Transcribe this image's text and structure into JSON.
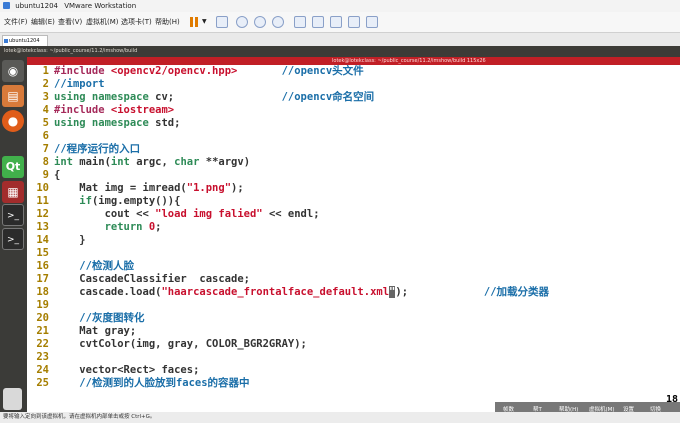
{
  "window": {
    "tab_title": "ubuntu1204",
    "app_title": "VMware Workstation"
  },
  "menu": [
    "文件(F)",
    "编辑(E)",
    "查看(V)",
    "虚拟机(M)",
    "选项卡(T)",
    "帮助(H)"
  ],
  "toolbar_icons": [
    "pause-icon",
    "dropdown-icon",
    "send-keys-icon",
    "snapshot-icon",
    "revert-snapshot-icon",
    "manage-snapshots-icon",
    "full-screen-icon",
    "unity-icon",
    "console-view-icon",
    "thumbnail-icon",
    "settings-icon"
  ],
  "vm_tab": {
    "label": "ubuntu1204"
  },
  "unity_topbar": {
    "title": "lotek@lotekclass: ~/public_course/11.2/imshow/build"
  },
  "terminal": {
    "title": "lotek@lotekclass: ~/public_course/11.2/imshow/build 115x26"
  },
  "launcher_icons": [
    "dash-home-icon",
    "files-icon",
    "firefox-icon",
    "qt-creator-icon",
    "app-icon",
    "terminal-icon",
    "terminal-2-icon",
    "trash-icon"
  ],
  "code_lines": [
    {
      "n": "1",
      "t": "#include <opencv2/opencv.hpp>       //opencv头文件"
    },
    {
      "n": "2",
      "t": "//import"
    },
    {
      "n": "3",
      "t": "using namespace cv;                 //opencv命名空间"
    },
    {
      "n": "4",
      "t": "#include <iostream>"
    },
    {
      "n": "5",
      "t": "using namespace std;"
    },
    {
      "n": "6",
      "t": ""
    },
    {
      "n": "7",
      "t": "//程序运行的入口"
    },
    {
      "n": "8",
      "t": "int main(int argc, char **argv)"
    },
    {
      "n": "9",
      "t": "{"
    },
    {
      "n": "10",
      "t": "    Mat img = imread(\"1.png\");"
    },
    {
      "n": "11",
      "t": "    if(img.empty()){"
    },
    {
      "n": "12",
      "t": "        cout << \"load img falied\" << endl;"
    },
    {
      "n": "13",
      "t": "        return 0;"
    },
    {
      "n": "14",
      "t": "    }"
    },
    {
      "n": "15",
      "t": ""
    },
    {
      "n": "16",
      "t": "    //检测人脸"
    },
    {
      "n": "17",
      "t": "    CascadeClassifier  cascade;"
    },
    {
      "n": "18",
      "t": "    cascade.load(\"haarcascade_frontalface_default.xml\");            //加载分类器"
    },
    {
      "n": "19",
      "t": ""
    },
    {
      "n": "20",
      "t": "    //灰度图转化"
    },
    {
      "n": "21",
      "t": "    Mat gray;"
    },
    {
      "n": "22",
      "t": "    cvtColor(img, gray, COLOR_BGR2GRAY);"
    },
    {
      "n": "23",
      "t": ""
    },
    {
      "n": "24",
      "t": "    vector<Rect> faces;"
    },
    {
      "n": "25",
      "t": "    //检测到的人脸放到faces的容器中"
    }
  ],
  "page_indicator": "18",
  "hint_bar": [
    "帧数",
    "帮T",
    "帮助(H)",
    "虚拟机(M)",
    "设置",
    "切换"
  ],
  "status_text": "要将输入定向到该虚拟机，请在虚拟机内部单击或按 Ctrl+G。",
  "colors": {
    "terminal_bar": "#c11f26",
    "launcher": "#3b3b38",
    "comment": "#1a6ea8",
    "keyword": "#2e8b57",
    "string": "#c8102e",
    "line_number": "#a57e00"
  }
}
